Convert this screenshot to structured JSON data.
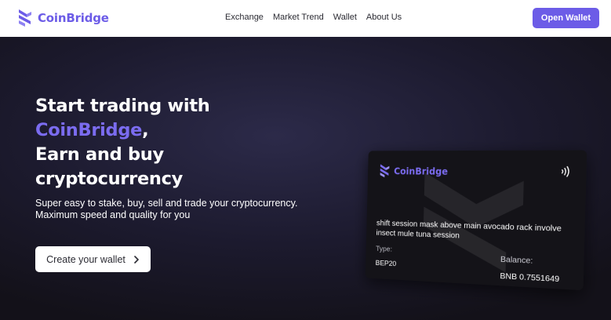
{
  "brand": {
    "name": "CoinBridge",
    "accent_color": "#6c5ce7"
  },
  "nav": {
    "links": [
      {
        "label": "Exchange"
      },
      {
        "label": "Market Trend"
      },
      {
        "label": "Wallet"
      },
      {
        "label": "About Us"
      }
    ],
    "open_wallet_label": "Open Wallet"
  },
  "hero": {
    "title_line1": "Start trading with",
    "title_accent": "CoinBridge",
    "title_comma": ",",
    "title_line3": "Earn and buy",
    "title_line4": "cryptocurrency",
    "subtitle": "Super easy to stake, buy, sell and trade your cryptocurrency. Maximum speed and quality for you",
    "cta_label": "Create your wallet",
    "cta_icon": "chevron-right-icon"
  },
  "card": {
    "brand": "CoinBridge",
    "icon": "contactless-icon",
    "phrase": "shift session mask above main avocado rack involve insect mule tuna session",
    "type_label": "Type:",
    "type_value": "BEP20",
    "balance_label": "Balance:",
    "balance_value": "BNB 0.7551649"
  }
}
